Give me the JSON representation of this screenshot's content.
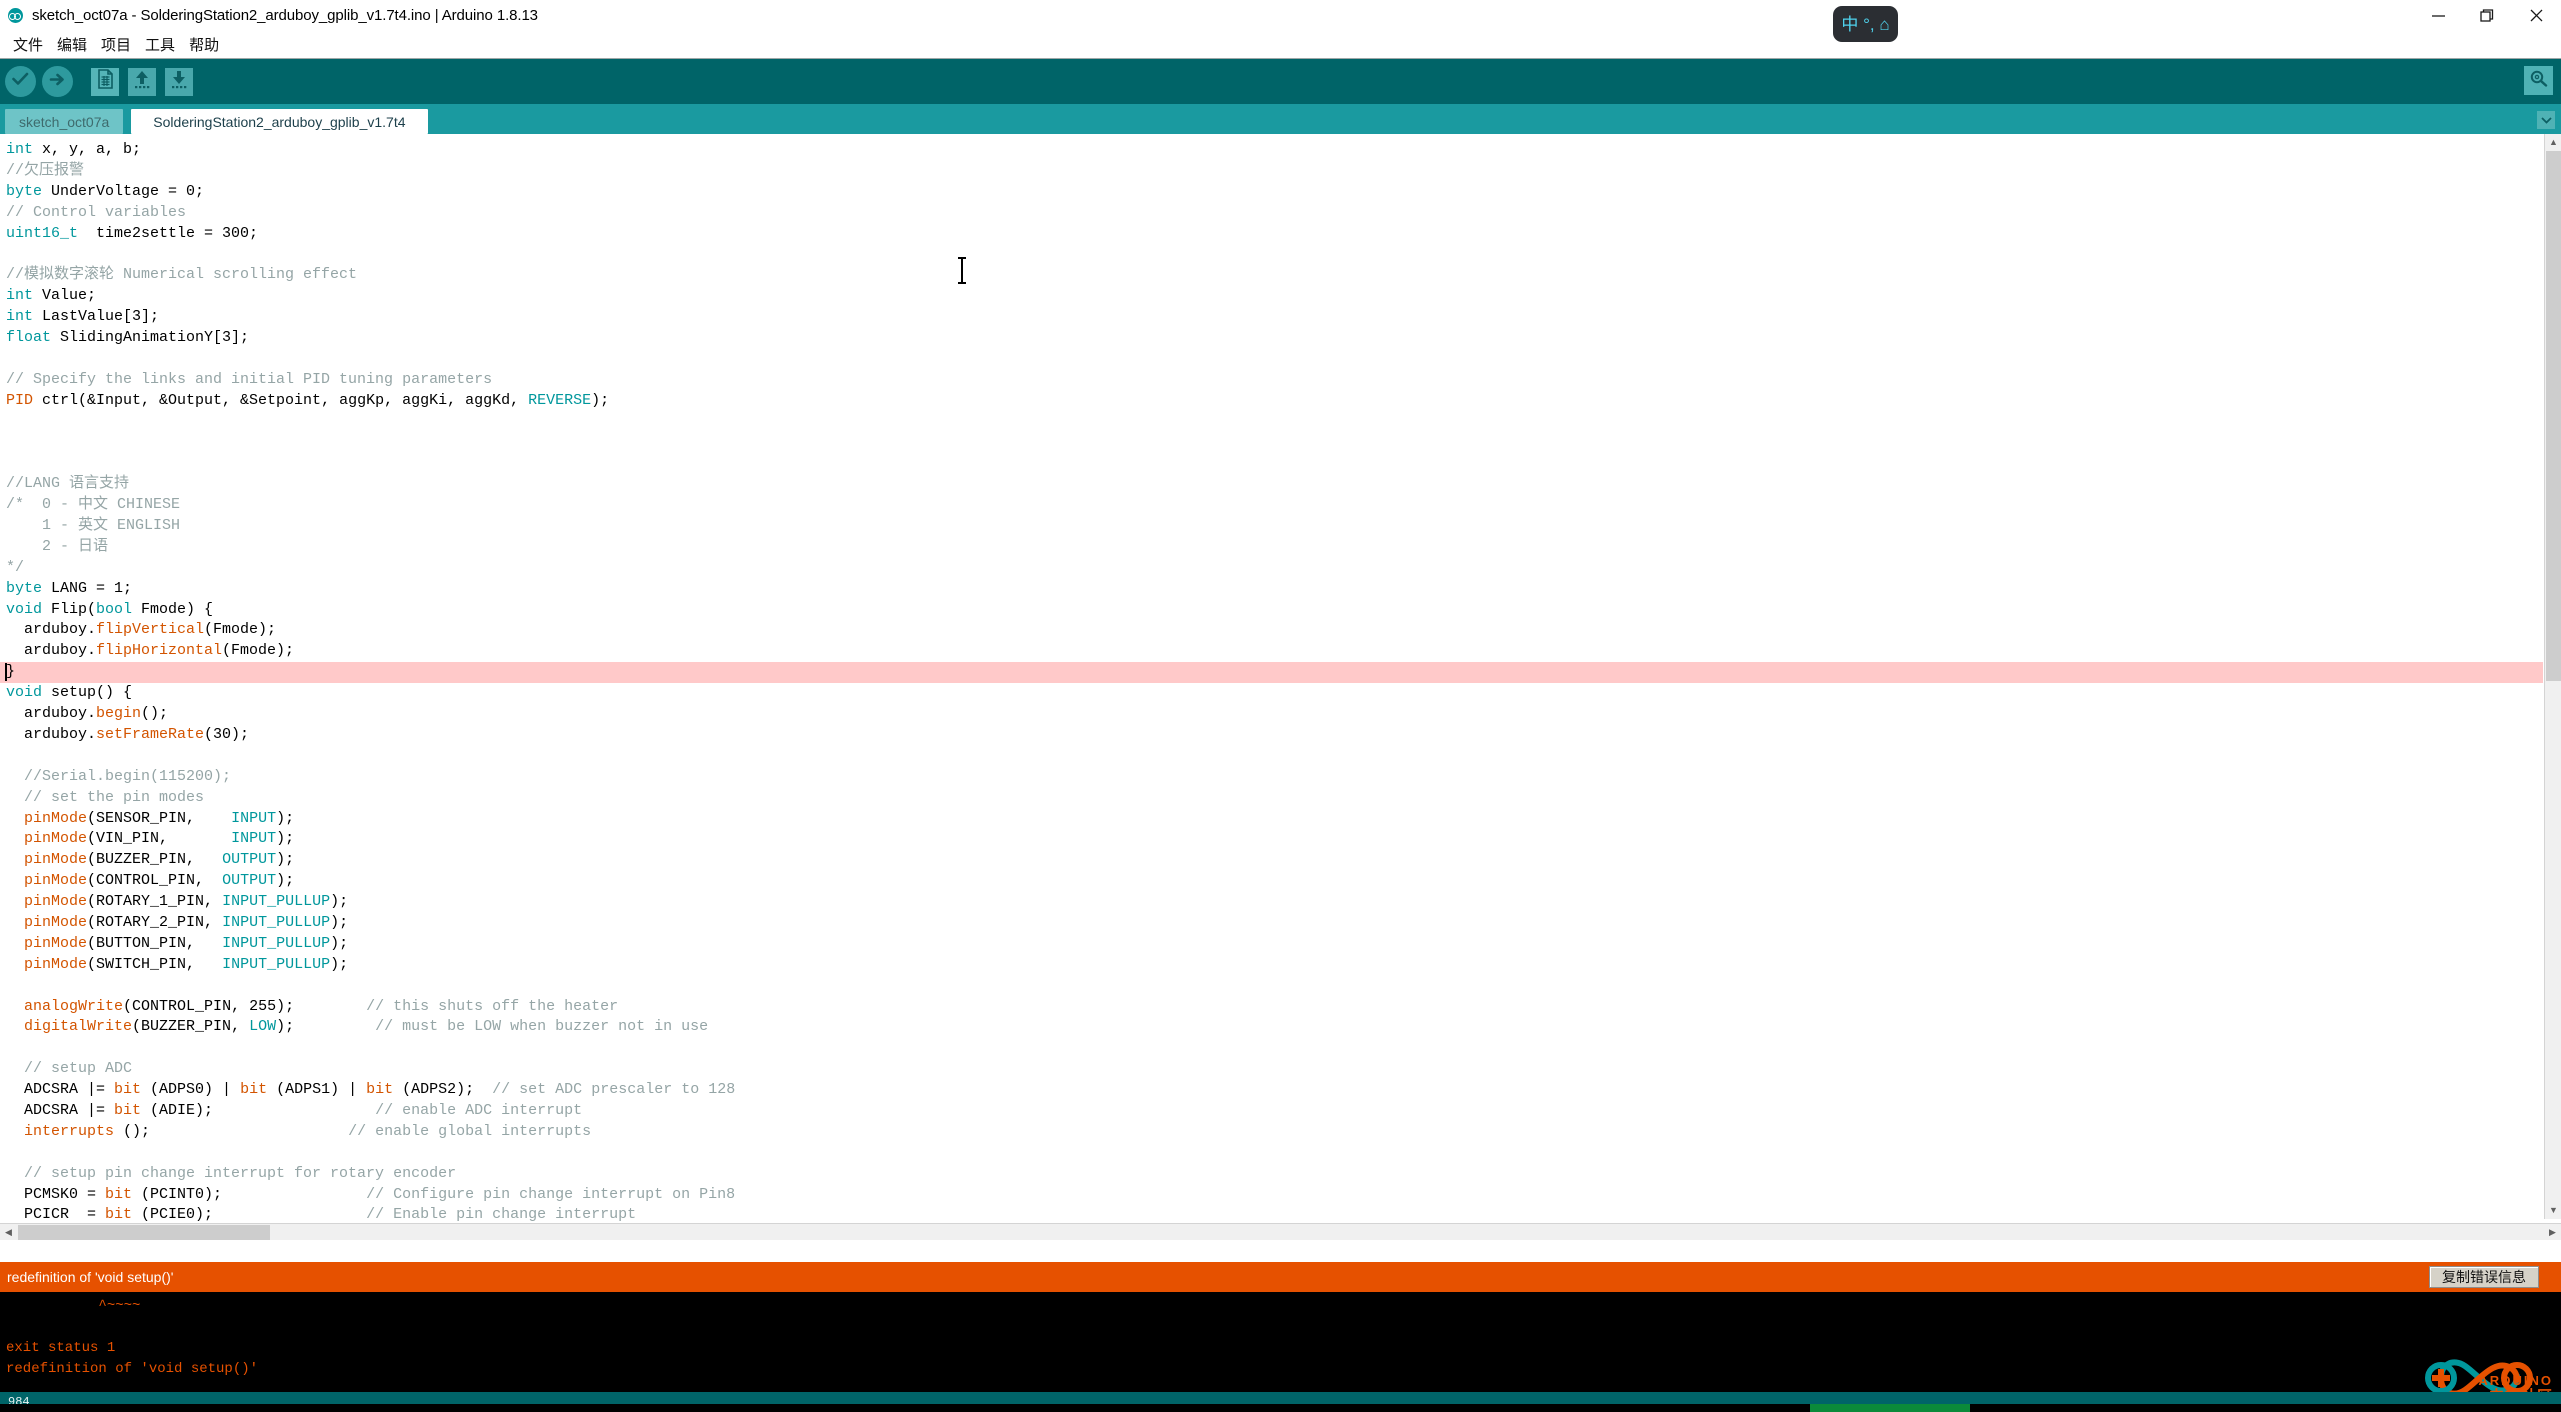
{
  "window": {
    "title": "sketch_oct07a - SolderingStation2_arduboy_gplib_v1.7t4.ino | Arduino 1.8.13",
    "app_icon": "arduino-infinity-icon",
    "controls": {
      "minimize": "minimize-icon",
      "maximize": "maximize-icon",
      "close": "close-icon"
    }
  },
  "menubar": {
    "items": [
      {
        "label": "文件"
      },
      {
        "label": "编辑"
      },
      {
        "label": "项目"
      },
      {
        "label": "工具"
      },
      {
        "label": "帮助"
      }
    ]
  },
  "toolbar": {
    "buttons": [
      {
        "name": "verify-button",
        "icon": "check-icon"
      },
      {
        "name": "upload-button",
        "icon": "arrow-right-icon"
      },
      {
        "name": "new-button",
        "icon": "new-file-icon"
      },
      {
        "name": "open-button",
        "icon": "arrow-up-icon"
      },
      {
        "name": "save-button",
        "icon": "arrow-down-icon"
      }
    ],
    "serial_monitor": {
      "name": "serial-monitor-button",
      "icon": "magnifier-icon"
    }
  },
  "tabs": {
    "items": [
      {
        "label": "sketch_oct07a",
        "active": false
      },
      {
        "label": "SolderingStation2_arduboy_gplib_v1.7t4",
        "active": true
      }
    ],
    "menu_icon": "chevron-down-icon"
  },
  "ime": {
    "mode_label": "中",
    "punctuation_label": "°,",
    "skin_label": "⌂"
  },
  "editor": {
    "highlighted_line_index": 25,
    "lines": [
      [
        {
          "t": "int",
          "c": "kw"
        },
        {
          "t": " x, y, a, b;",
          "c": "lit"
        }
      ],
      [
        {
          "t": "//欠压报警",
          "c": "cmt"
        }
      ],
      [
        {
          "t": "byte",
          "c": "kw"
        },
        {
          "t": " UnderVoltage = 0;",
          "c": "lit"
        }
      ],
      [
        {
          "t": "// Control variables",
          "c": "cmt"
        }
      ],
      [
        {
          "t": "uint16_t",
          "c": "kw"
        },
        {
          "t": "  time2settle = 300;",
          "c": "lit"
        }
      ],
      [
        {
          "t": "",
          "c": "lit"
        }
      ],
      [
        {
          "t": "//模拟数字滚轮 Numerical scrolling effect",
          "c": "cmt"
        }
      ],
      [
        {
          "t": "int",
          "c": "kw"
        },
        {
          "t": " Value;",
          "c": "lit"
        }
      ],
      [
        {
          "t": "int",
          "c": "kw"
        },
        {
          "t": " LastValue[3];",
          "c": "lit"
        }
      ],
      [
        {
          "t": "float",
          "c": "kw"
        },
        {
          "t": " SlidingAnimationY[3];",
          "c": "lit"
        }
      ],
      [
        {
          "t": "",
          "c": "lit"
        }
      ],
      [
        {
          "t": "// Specify the links and initial PID tuning parameters",
          "c": "cmt"
        }
      ],
      [
        {
          "t": "PID",
          "c": "pid"
        },
        {
          "t": " ctrl(&Input, &Output, &Setpoint, aggKp, aggKi, aggKd, ",
          "c": "lit"
        },
        {
          "t": "REVERSE",
          "c": "cns"
        },
        {
          "t": ");",
          "c": "lit"
        }
      ],
      [
        {
          "t": "",
          "c": "lit"
        }
      ],
      [
        {
          "t": "",
          "c": "lit"
        }
      ],
      [
        {
          "t": "",
          "c": "lit"
        }
      ],
      [
        {
          "t": "//LANG 语言支持",
          "c": "cmt"
        }
      ],
      [
        {
          "t": "/*  0 - 中文 CHINESE",
          "c": "cmt"
        }
      ],
      [
        {
          "t": "    1 - 英文 ENGLISH",
          "c": "cmt"
        }
      ],
      [
        {
          "t": "    2 - 日语",
          "c": "cmt"
        }
      ],
      [
        {
          "t": "*/",
          "c": "cmt"
        }
      ],
      [
        {
          "t": "byte",
          "c": "kw"
        },
        {
          "t": " LANG = 1;",
          "c": "lit"
        }
      ],
      [
        {
          "t": "void",
          "c": "kw"
        },
        {
          "t": " Flip(",
          "c": "lit"
        },
        {
          "t": "bool",
          "c": "kw"
        },
        {
          "t": " Fmode) {",
          "c": "lit"
        }
      ],
      [
        {
          "t": "  arduboy.",
          "c": "lit"
        },
        {
          "t": "flipVertical",
          "c": "fn"
        },
        {
          "t": "(Fmode);",
          "c": "lit"
        }
      ],
      [
        {
          "t": "  arduboy.",
          "c": "lit"
        },
        {
          "t": "flipHorizontal",
          "c": "fn"
        },
        {
          "t": "(Fmode);",
          "c": "lit"
        }
      ],
      [
        {
          "t": "}",
          "c": "lit"
        }
      ],
      [
        {
          "t": "void",
          "c": "kw"
        },
        {
          "t": " setup() {",
          "c": "lit"
        }
      ],
      [
        {
          "t": "  arduboy.",
          "c": "lit"
        },
        {
          "t": "begin",
          "c": "fn"
        },
        {
          "t": "();",
          "c": "lit"
        }
      ],
      [
        {
          "t": "  arduboy.",
          "c": "lit"
        },
        {
          "t": "setFrameRate",
          "c": "fn"
        },
        {
          "t": "(30);",
          "c": "lit"
        }
      ],
      [
        {
          "t": "",
          "c": "lit"
        }
      ],
      [
        {
          "t": "  //Serial.begin(115200);",
          "c": "cmt"
        }
      ],
      [
        {
          "t": "  // set the pin modes",
          "c": "cmt"
        }
      ],
      [
        {
          "t": "  ",
          "c": "lit"
        },
        {
          "t": "pinMode",
          "c": "fn"
        },
        {
          "t": "(SENSOR_PIN,    ",
          "c": "lit"
        },
        {
          "t": "INPUT",
          "c": "cns"
        },
        {
          "t": ");",
          "c": "lit"
        }
      ],
      [
        {
          "t": "  ",
          "c": "lit"
        },
        {
          "t": "pinMode",
          "c": "fn"
        },
        {
          "t": "(VIN_PIN,       ",
          "c": "lit"
        },
        {
          "t": "INPUT",
          "c": "cns"
        },
        {
          "t": ");",
          "c": "lit"
        }
      ],
      [
        {
          "t": "  ",
          "c": "lit"
        },
        {
          "t": "pinMode",
          "c": "fn"
        },
        {
          "t": "(BUZZER_PIN,   ",
          "c": "lit"
        },
        {
          "t": "OUTPUT",
          "c": "cns"
        },
        {
          "t": ");",
          "c": "lit"
        }
      ],
      [
        {
          "t": "  ",
          "c": "lit"
        },
        {
          "t": "pinMode",
          "c": "fn"
        },
        {
          "t": "(CONTROL_PIN,  ",
          "c": "lit"
        },
        {
          "t": "OUTPUT",
          "c": "cns"
        },
        {
          "t": ");",
          "c": "lit"
        }
      ],
      [
        {
          "t": "  ",
          "c": "lit"
        },
        {
          "t": "pinMode",
          "c": "fn"
        },
        {
          "t": "(ROTARY_1_PIN, ",
          "c": "lit"
        },
        {
          "t": "INPUT_PULLUP",
          "c": "cns"
        },
        {
          "t": ");",
          "c": "lit"
        }
      ],
      [
        {
          "t": "  ",
          "c": "lit"
        },
        {
          "t": "pinMode",
          "c": "fn"
        },
        {
          "t": "(ROTARY_2_PIN, ",
          "c": "lit"
        },
        {
          "t": "INPUT_PULLUP",
          "c": "cns"
        },
        {
          "t": ");",
          "c": "lit"
        }
      ],
      [
        {
          "t": "  ",
          "c": "lit"
        },
        {
          "t": "pinMode",
          "c": "fn"
        },
        {
          "t": "(BUTTON_PIN,   ",
          "c": "lit"
        },
        {
          "t": "INPUT_PULLUP",
          "c": "cns"
        },
        {
          "t": ");",
          "c": "lit"
        }
      ],
      [
        {
          "t": "  ",
          "c": "lit"
        },
        {
          "t": "pinMode",
          "c": "fn"
        },
        {
          "t": "(SWITCH_PIN,   ",
          "c": "lit"
        },
        {
          "t": "INPUT_PULLUP",
          "c": "cns"
        },
        {
          "t": ");",
          "c": "lit"
        }
      ],
      [
        {
          "t": "",
          "c": "lit"
        }
      ],
      [
        {
          "t": "  ",
          "c": "lit"
        },
        {
          "t": "analogWrite",
          "c": "fn"
        },
        {
          "t": "(CONTROL_PIN, 255);        ",
          "c": "lit"
        },
        {
          "t": "// this shuts off the heater",
          "c": "cmt"
        }
      ],
      [
        {
          "t": "  ",
          "c": "lit"
        },
        {
          "t": "digitalWrite",
          "c": "fn"
        },
        {
          "t": "(BUZZER_PIN, ",
          "c": "lit"
        },
        {
          "t": "LOW",
          "c": "cns"
        },
        {
          "t": ");         ",
          "c": "lit"
        },
        {
          "t": "// must be LOW when buzzer not in use",
          "c": "cmt"
        }
      ],
      [
        {
          "t": "",
          "c": "lit"
        }
      ],
      [
        {
          "t": "  // setup ADC",
          "c": "cmt"
        }
      ],
      [
        {
          "t": "  ADCSRA |= ",
          "c": "lit"
        },
        {
          "t": "bit",
          "c": "fn"
        },
        {
          "t": " (ADPS0) | ",
          "c": "lit"
        },
        {
          "t": "bit",
          "c": "fn"
        },
        {
          "t": " (ADPS1) | ",
          "c": "lit"
        },
        {
          "t": "bit",
          "c": "fn"
        },
        {
          "t": " (ADPS2);  ",
          "c": "lit"
        },
        {
          "t": "// set ADC prescaler to 128",
          "c": "cmt"
        }
      ],
      [
        {
          "t": "  ADCSRA |= ",
          "c": "lit"
        },
        {
          "t": "bit",
          "c": "fn"
        },
        {
          "t": " (ADIE);                  ",
          "c": "lit"
        },
        {
          "t": "// enable ADC interrupt",
          "c": "cmt"
        }
      ],
      [
        {
          "t": "  ",
          "c": "lit"
        },
        {
          "t": "interrupts",
          "c": "fn"
        },
        {
          "t": " ();                      ",
          "c": "lit"
        },
        {
          "t": "// enable global interrupts",
          "c": "cmt"
        }
      ],
      [
        {
          "t": "",
          "c": "lit"
        }
      ],
      [
        {
          "t": "  // setup pin change interrupt for rotary encoder",
          "c": "cmt"
        }
      ],
      [
        {
          "t": "  PCMSK0 = ",
          "c": "lit"
        },
        {
          "t": "bit",
          "c": "fn"
        },
        {
          "t": " (PCINT0);                ",
          "c": "lit"
        },
        {
          "t": "// Configure pin change interrupt on Pin8",
          "c": "cmt"
        }
      ],
      [
        {
          "t": "  PCICR  = ",
          "c": "lit"
        },
        {
          "t": "bit",
          "c": "fn"
        },
        {
          "t": " (PCIE0);                 ",
          "c": "lit"
        },
        {
          "t": "// Enable pin change interrupt",
          "c": "cmt"
        }
      ]
    ]
  },
  "error_bar": {
    "message": "redefinition of 'void setup()'",
    "copy_button": "复制错误信息",
    "color": "#e65100"
  },
  "console": {
    "text": "           ^~~~~\n\nexit status 1\nredefinition of 'void setup()'"
  },
  "statusbar": {
    "line_number": "984"
  },
  "watermark": {
    "brand": "ARDUINO",
    "community": "中文社区"
  }
}
